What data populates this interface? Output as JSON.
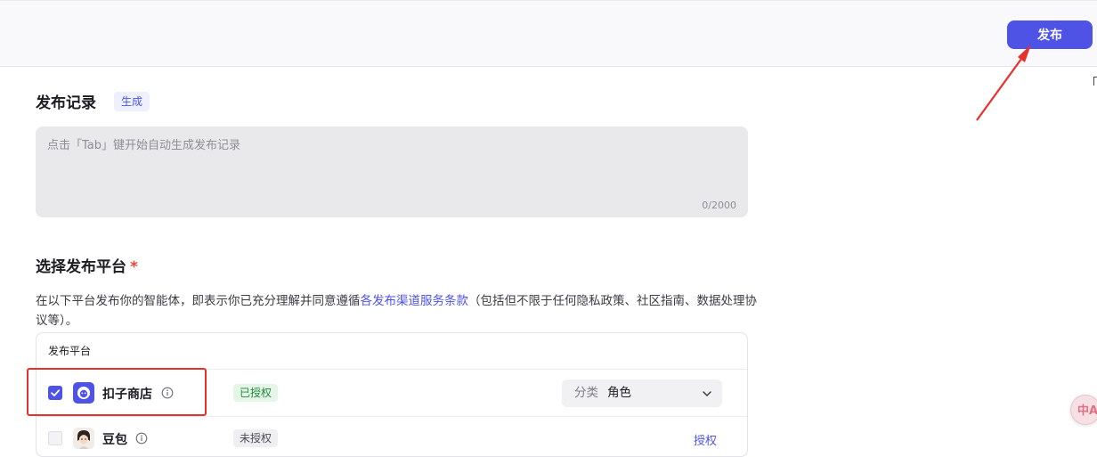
{
  "header": {
    "publish_label": "发布"
  },
  "record": {
    "title": "发布记录",
    "generate_tag": "生成",
    "placeholder": "点击「Tab」键开始自动生成发布记录",
    "counter": "0/2000"
  },
  "platform_section": {
    "title": "选择发布平台",
    "required_mark": "*",
    "terms_before": "在以下平台发布你的智能体，即表示你已充分理解并同意遵循",
    "terms_link": "各发布渠道服务条款",
    "terms_after": "（包括但不限于任何隐私政策、社区指南、数据处理协议等）。",
    "table_header": "发布平台",
    "rows": [
      {
        "name": "扣子商店",
        "checked": true,
        "status": "已授权",
        "category_label": "分类",
        "category_value": "角色"
      },
      {
        "name": "豆包",
        "checked": false,
        "status": "未授权",
        "action": "授权"
      }
    ]
  },
  "float_widget": {
    "text": "中A"
  },
  "colors": {
    "accent": "#4e53e6",
    "annotation": "#e5322d",
    "status_ok": "#1f8a3a"
  },
  "icons": [
    "check-icon",
    "store-bot-icon",
    "info-icon",
    "chevron-down-icon",
    "doubao-avatar-icon"
  ]
}
